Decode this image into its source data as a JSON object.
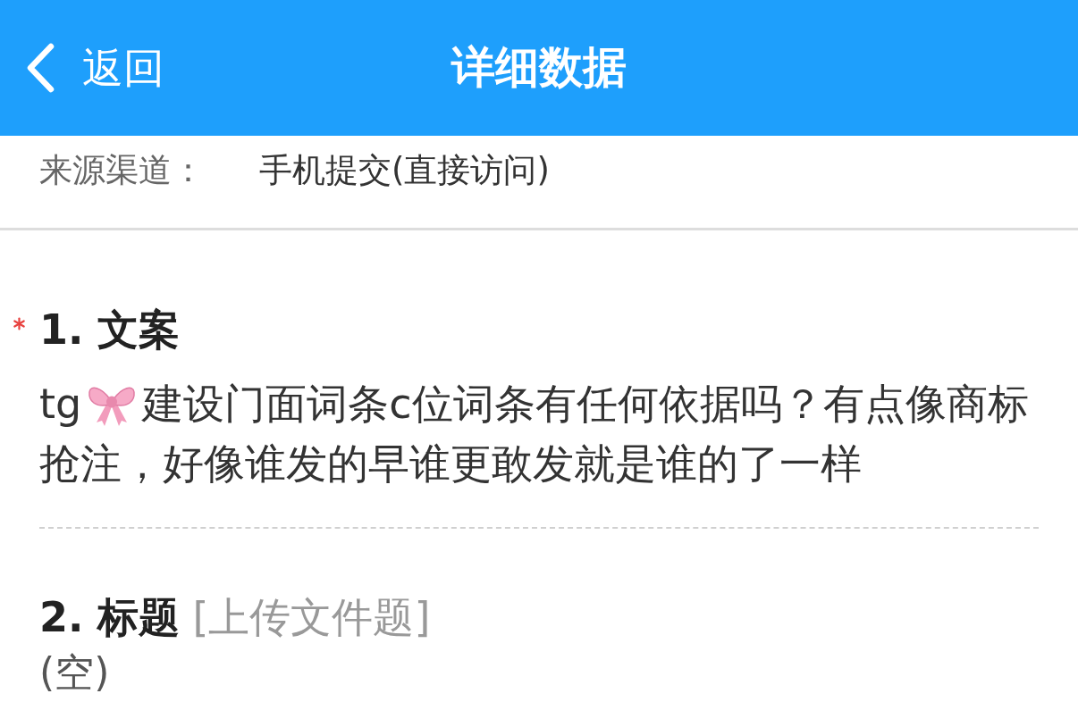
{
  "header": {
    "back_label": "返回",
    "title": "详细数据"
  },
  "source": {
    "label": "来源渠道：",
    "value": "手机提交(直接访问)"
  },
  "questions": [
    {
      "title": "1. 文案",
      "required": true,
      "answer_lines": [
        [
          {
            "kind": "text",
            "text": "tg"
          },
          {
            "kind": "icon"
          },
          {
            "kind": "text",
            "text": "建设门面词条c位词条有任何依据吗？有点像商标"
          }
        ],
        [
          {
            "kind": "text",
            "text": "抢注，好像谁发的早谁更敢发就是谁的了一样"
          }
        ]
      ]
    },
    {
      "title": "2. 标题",
      "type_label": "[上传文件题]",
      "required": false,
      "answer_lines": [
        [
          {
            "kind": "text",
            "text": "(空)"
          }
        ]
      ]
    }
  ]
}
